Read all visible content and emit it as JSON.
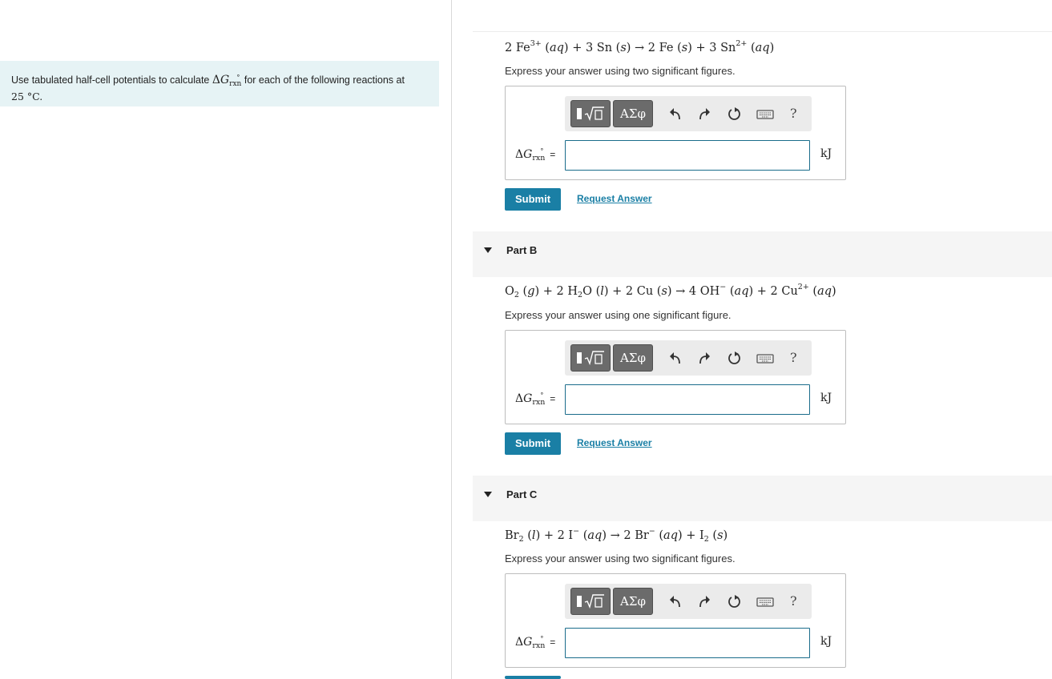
{
  "instructions": {
    "text_before": "Use tabulated half-cell potentials to calculate",
    "symbol_delta": "Δ",
    "symbol_g": "G",
    "symbol_sub": "rxn",
    "symbol_sup": "°",
    "text_after": "for each of the following reactions at",
    "temp": "25 °C."
  },
  "toolbar": {
    "template_icon": "template-sqrt-icon",
    "greek_label": "ΑΣφ",
    "help_label": "?"
  },
  "answer_label": {
    "delta": "Δ",
    "g": "G",
    "sub": "rxn",
    "sup": "°",
    "equals": "="
  },
  "unit": "kJ",
  "submit_label": "Submit",
  "request_answer_label": "Request Answer",
  "parts": [
    {
      "title": "",
      "reaction": "2 Fe3+ (aq) + 3 Sn (s) → 2 Fe (s) + 3 Sn2+ (aq)",
      "instruction": "Express your answer using two significant figures.",
      "input_value": ""
    },
    {
      "title": "Part B",
      "reaction": "O2 (g) + 2 H2O (l) + 2 Cu (s) → 4 OH− (aq) + 2 Cu2+ (aq)",
      "instruction": "Express your answer using one significant figure.",
      "input_value": ""
    },
    {
      "title": "Part C",
      "reaction": "Br2 (l) + 2 I− (aq) → 2 Br− (aq) + I2 (s)",
      "instruction": "Express your answer using two significant figures.",
      "input_value": ""
    }
  ],
  "colors": {
    "accent": "#1a7fa5",
    "instruction_bg": "#e6f3f5",
    "part_header_bg": "#f5f5f5",
    "toolbar_button": "#6b6b6b"
  }
}
